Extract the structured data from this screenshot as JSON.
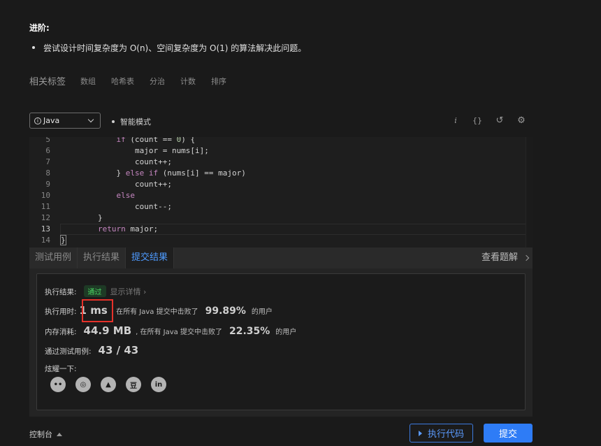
{
  "advanced": {
    "title": "进阶:",
    "item": "尝试设计时间复杂度为 O(n)、空间复杂度为 O(1) 的算法解决此问题。"
  },
  "tags": {
    "label": "相关标签",
    "items": [
      "数组",
      "哈希表",
      "分治",
      "计数",
      "排序"
    ]
  },
  "toolbar": {
    "language": "Java",
    "mode": "智能模式",
    "icons": [
      "info-icon",
      "braces-icon",
      "reset-icon",
      "settings-icon"
    ],
    "info_glyph": "i",
    "braces_glyph": "{}",
    "reset_glyph": "↺",
    "settings_glyph": "⚙"
  },
  "editor": {
    "lines": [
      {
        "n": "5",
        "segs": [
          {
            "t": "            ",
            "c": ""
          },
          {
            "t": "if",
            "c": "kw"
          },
          {
            "t": " (count == ",
            "c": ""
          },
          {
            "t": "0",
            "c": "num"
          },
          {
            "t": ") {",
            "c": ""
          }
        ]
      },
      {
        "n": "6",
        "segs": [
          {
            "t": "                major = nums[i];",
            "c": ""
          }
        ]
      },
      {
        "n": "7",
        "segs": [
          {
            "t": "                count++;",
            "c": ""
          }
        ]
      },
      {
        "n": "8",
        "segs": [
          {
            "t": "            } ",
            "c": ""
          },
          {
            "t": "else if",
            "c": "kw"
          },
          {
            "t": " (nums[i] == major)",
            "c": ""
          }
        ]
      },
      {
        "n": "9",
        "segs": [
          {
            "t": "                count++;",
            "c": ""
          }
        ]
      },
      {
        "n": "10",
        "segs": [
          {
            "t": "            ",
            "c": ""
          },
          {
            "t": "else",
            "c": "kw"
          }
        ]
      },
      {
        "n": "11",
        "segs": [
          {
            "t": "                count--;",
            "c": ""
          }
        ]
      },
      {
        "n": "12",
        "segs": [
          {
            "t": "        }",
            "c": ""
          }
        ]
      },
      {
        "n": "13",
        "segs": [
          {
            "t": "        ",
            "c": ""
          },
          {
            "t": "return",
            "c": "kw"
          },
          {
            "t": " major;",
            "c": ""
          }
        ],
        "current": true
      },
      {
        "n": "14",
        "segs": [
          {
            "t": "}",
            "c": "brace"
          }
        ]
      }
    ]
  },
  "result_tabs": {
    "tabs": [
      "测试用例",
      "执行结果",
      "提交结果"
    ],
    "active_index": 2,
    "view_solution": "查看题解"
  },
  "result": {
    "status_label": "执行结果:",
    "status": "通过",
    "details_link": "显示详情",
    "details_arrow": "›",
    "runtime_label": "执行用时:",
    "runtime_value": "1 ms",
    "runtime_text": ", 在所有 Java 提交中击败了",
    "runtime_pct": "99.89%",
    "runtime_suffix": "的用户",
    "memory_label": "内存消耗:",
    "memory_value": "44.9 MB",
    "memory_text": ", 在所有 Java 提交中击败了",
    "memory_pct": "22.35%",
    "memory_suffix": "的用户",
    "tests_label": "通过测试用例:",
    "tests_value": "43 / 43",
    "share_label": "炫耀一下:",
    "share_icons": [
      {
        "name": "wechat-icon",
        "glyph": "••"
      },
      {
        "name": "weibo-icon",
        "glyph": "◎"
      },
      {
        "name": "qq-icon",
        "glyph": "▲"
      },
      {
        "name": "douban-icon",
        "glyph": "豆"
      },
      {
        "name": "linkedin-icon",
        "glyph": "in"
      }
    ]
  },
  "footer": {
    "console": "控制台",
    "run": "执行代码",
    "submit": "提交"
  },
  "colors": {
    "accent": "#2e7cf6",
    "pass": "#4cd964",
    "highlight": "#e6322a"
  }
}
